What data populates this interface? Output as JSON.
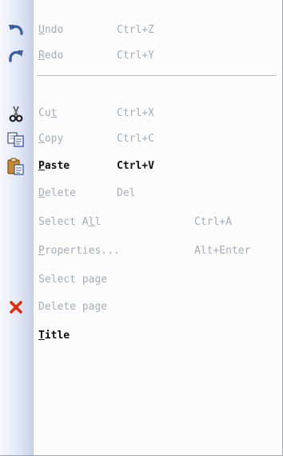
{
  "menu": {
    "items": [
      {
        "id": "undo",
        "pre": "",
        "mn": "U",
        "post": "ndo",
        "shortcut": "Ctrl+Z",
        "icon": "undo-arrow-icon",
        "enabled": false
      },
      {
        "id": "redo",
        "pre": "",
        "mn": "R",
        "post": "edo",
        "shortcut": "Ctrl+Y",
        "icon": "redo-arrow-icon",
        "enabled": false
      },
      {
        "id": "cut",
        "pre": "Cu",
        "mn": "t",
        "post": "",
        "shortcut": "Ctrl+X",
        "icon": "scissors-icon",
        "enabled": false
      },
      {
        "id": "copy",
        "pre": "",
        "mn": "C",
        "post": "opy",
        "shortcut": "Ctrl+C",
        "icon": "copy-icon",
        "enabled": false
      },
      {
        "id": "paste",
        "pre": "",
        "mn": "P",
        "post": "aste",
        "shortcut": "Ctrl+V",
        "icon": "clipboard-paste-icon",
        "enabled": true
      },
      {
        "id": "delete",
        "pre": "",
        "mn": "D",
        "post": "elete",
        "shortcut": "Del",
        "icon": "",
        "enabled": false
      },
      {
        "id": "select-all",
        "pre": "Select A",
        "mn": "l",
        "post": "l",
        "shortcut": "Ctrl+A",
        "icon": "",
        "enabled": false
      },
      {
        "id": "properties",
        "pre": "",
        "mn": "P",
        "post": "roperties...",
        "shortcut": "Alt+Enter",
        "icon": "",
        "enabled": false
      },
      {
        "id": "select-page",
        "pre": "Select page",
        "mn": "",
        "post": "",
        "shortcut": "",
        "icon": "",
        "enabled": false
      },
      {
        "id": "delete-page",
        "pre": "Delete page",
        "mn": "",
        "post": "",
        "shortcut": "",
        "icon": "red-x-icon",
        "enabled": false
      },
      {
        "id": "title",
        "pre": "",
        "mn": "T",
        "post": "itle",
        "shortcut": "",
        "icon": "",
        "enabled": true
      }
    ],
    "colors": {
      "disabled_text": "#a9acb5",
      "enabled_text": "#111111",
      "gutter_start": "#f7f8fc",
      "gutter_end": "#c5cfe8",
      "delete_x": "#e8290c"
    }
  }
}
